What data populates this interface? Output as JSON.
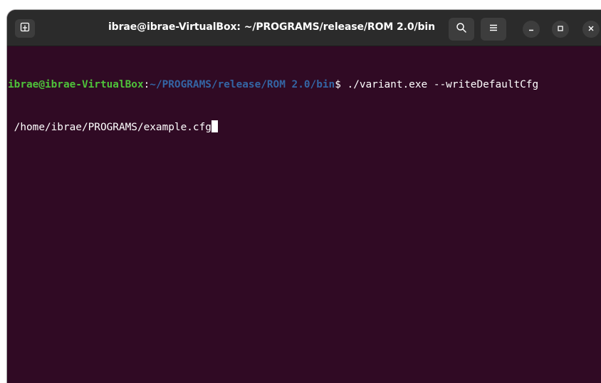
{
  "window": {
    "title": "ibrae@ibrae-VirtualBox: ~/PROGRAMS/release/ROM 2.0/bin"
  },
  "header_buttons": {
    "new_tab_icon": "new-tab-icon",
    "search_icon": "search-icon",
    "menu_icon": "hamburger-menu-icon",
    "minimize_icon": "minimize-icon",
    "maximize_icon": "maximize-icon",
    "close_icon": "close-icon"
  },
  "terminal": {
    "prompt_user_host": "ibrae@ibrae-VirtualBox",
    "prompt_colon": ":",
    "prompt_path": "~/PROGRAMS/release/ROM 2.0/bin",
    "prompt_symbol": "$ ",
    "command": "./variant.exe --writeDefaultCfg",
    "output_line": " /home/ibrae/PROGRAMS/example.cfg"
  },
  "colors": {
    "terminal_bg": "#300a24",
    "titlebar_bg": "#2b2b2b",
    "prompt_user": "#4ec23a",
    "prompt_path": "#3465a4",
    "text": "#ffffff"
  }
}
